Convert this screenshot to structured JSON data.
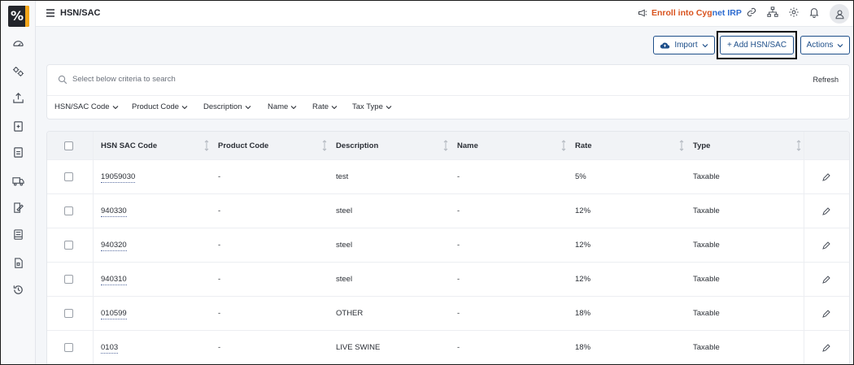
{
  "header": {
    "page_title": "HSN/SAC",
    "enroll_part1": "Enroll into Cyg",
    "enroll_part2": "net IRP"
  },
  "actions": {
    "import_label": "Import",
    "add_label": "+ Add HSN/SAC",
    "actions_label": "Actions"
  },
  "search": {
    "placeholder": "Select below criteria to search",
    "refresh_label": "Refresh"
  },
  "filters": [
    "HSN/SAC Code",
    "Product Code",
    "Description",
    "Name",
    "Rate",
    "Tax Type"
  ],
  "table": {
    "columns": [
      "HSN SAC Code",
      "Product Code",
      "Description",
      "Name",
      "Rate",
      "Type"
    ],
    "rows": [
      {
        "code": "19059030",
        "product": "-",
        "description": "test",
        "name": "-",
        "rate": "5%",
        "type": "Taxable"
      },
      {
        "code": "940330",
        "product": "-",
        "description": "steel",
        "name": "-",
        "rate": "12%",
        "type": "Taxable"
      },
      {
        "code": "940320",
        "product": "-",
        "description": "steel",
        "name": "-",
        "rate": "12%",
        "type": "Taxable"
      },
      {
        "code": "940310",
        "product": "-",
        "description": "steel",
        "name": "-",
        "rate": "12%",
        "type": "Taxable"
      },
      {
        "code": "010599",
        "product": "-",
        "description": "OTHER",
        "name": "-",
        "rate": "18%",
        "type": "Taxable"
      },
      {
        "code": "0103",
        "product": "-",
        "description": "LIVE SWINE",
        "name": "-",
        "rate": "18%",
        "type": "Taxable"
      }
    ]
  },
  "icons": {
    "sidebar": [
      "dashboard-icon",
      "settings-group-icon",
      "upload-icon",
      "document-plus-icon",
      "document-icon",
      "truck-icon",
      "edit-document-icon",
      "ledger-icon",
      "report-icon",
      "history-icon"
    ],
    "topbar": [
      "megaphone-icon",
      "link-icon",
      "network-icon",
      "gear-icon",
      "bell-icon",
      "user-icon"
    ]
  },
  "colors": {
    "accent": "#1e4f8a",
    "logo_bar": "#f2a51a",
    "enroll_orange": "#d9531e",
    "enroll_blue": "#2d6bd0"
  }
}
